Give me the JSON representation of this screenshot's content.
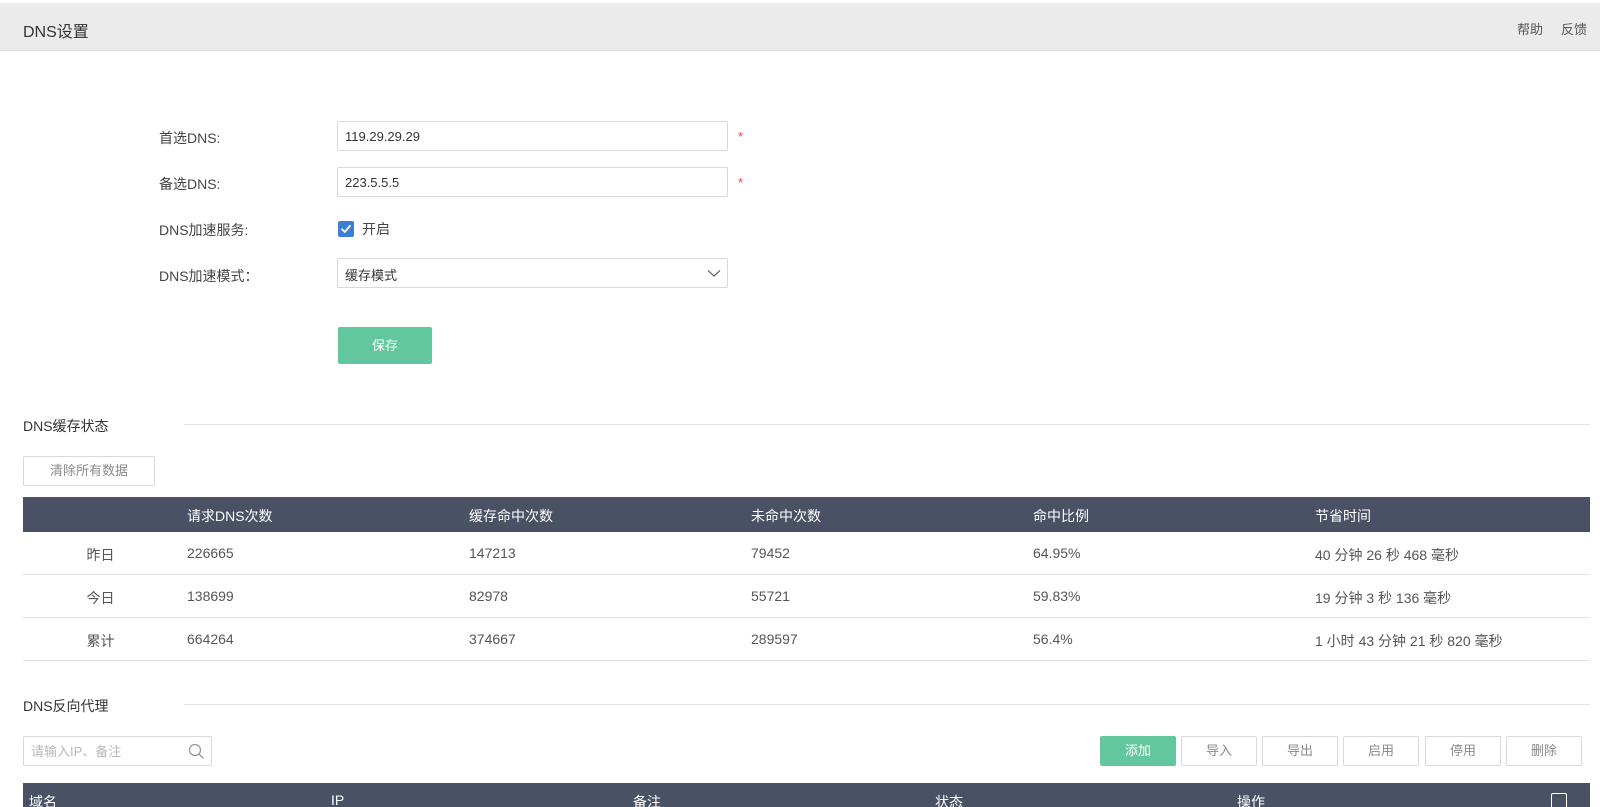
{
  "header": {
    "title": "DNS设置",
    "help": "帮助",
    "feedback": "反馈"
  },
  "form": {
    "primary_dns": {
      "label": "首选DNS:",
      "value": "119.29.29.29",
      "required": "*"
    },
    "secondary_dns": {
      "label": "备选DNS:",
      "value": "223.5.5.5",
      "required": "*"
    },
    "accel_service": {
      "label": "DNS加速服务:",
      "checkbox_label": "开启",
      "checked": true
    },
    "accel_mode": {
      "label": "DNS加速模式：",
      "selected": "缓存模式"
    },
    "save_label": "保存"
  },
  "cache_status": {
    "title": "DNS缓存状态",
    "clear_label": "清除所有数据",
    "columns": [
      "请求DNS次数",
      "缓存命中次数",
      "未命中次数",
      "命中比例",
      "节省时间"
    ],
    "rows": [
      {
        "label": "昨日",
        "cells": [
          "226665",
          "147213",
          "79452",
          "64.95%",
          "40 分钟 26 秒 468 毫秒"
        ]
      },
      {
        "label": "今日",
        "cells": [
          "138699",
          "82978",
          "55721",
          "59.83%",
          "19 分钟 3 秒 136 毫秒"
        ]
      },
      {
        "label": "累计",
        "cells": [
          "664264",
          "374667",
          "289597",
          "56.4%",
          "1 小时 43 分钟 21 秒 820 毫秒"
        ]
      }
    ]
  },
  "reverse_proxy": {
    "title": "DNS反向代理",
    "search_placeholder": "请输入IP、备注",
    "actions": {
      "add": "添加",
      "import": "导入",
      "export": "导出",
      "enable": "启用",
      "disable": "停用",
      "delete": "删除"
    },
    "columns": [
      "域名",
      "IP",
      "备注",
      "状态",
      "操作"
    ]
  },
  "colors": {
    "accent_green": "#62c79f",
    "table_header": "#4b5164",
    "checkbox_blue": "#3c7ed4",
    "required_red": "#e8474b"
  }
}
